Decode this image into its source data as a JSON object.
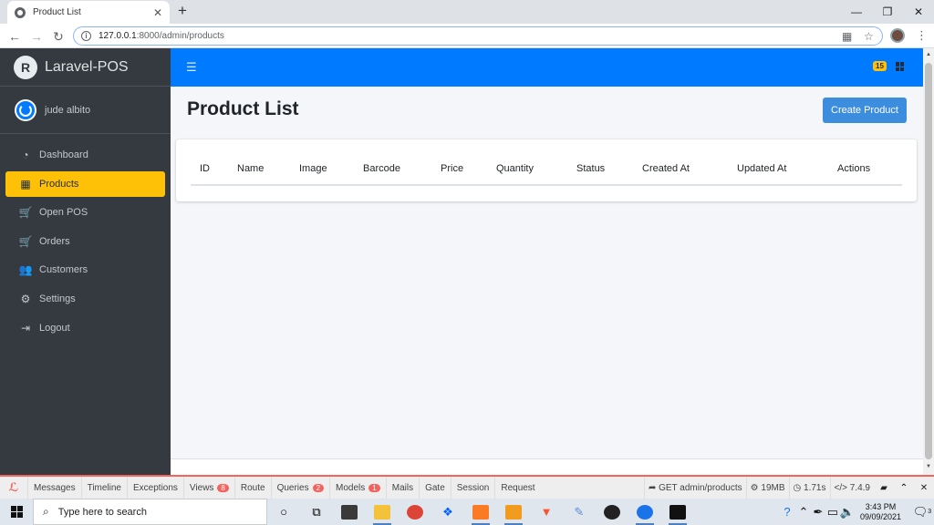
{
  "browser": {
    "tab_title": "Product List",
    "url_host": "127.0.0.1",
    "url_rest": ":8000/admin/products"
  },
  "app": {
    "brand": "Laravel-POS",
    "user_name": "jude albito",
    "notification_count": "15",
    "menu": [
      {
        "label": "Dashboard",
        "icon": "dashboard-icon",
        "active": false
      },
      {
        "label": "Products",
        "icon": "grid-icon",
        "active": true
      },
      {
        "label": "Open POS",
        "icon": "cart-icon",
        "active": false
      },
      {
        "label": "Orders",
        "icon": "cart-icon",
        "active": false
      },
      {
        "label": "Customers",
        "icon": "users-icon",
        "active": false
      },
      {
        "label": "Settings",
        "icon": "gears-icon",
        "active": false
      },
      {
        "label": "Logout",
        "icon": "logout-icon",
        "active": false
      }
    ],
    "page_title": "Product List",
    "create_button": "Create Product",
    "table_headers": [
      "ID",
      "Name",
      "Image",
      "Barcode",
      "Price",
      "Quantity",
      "Status",
      "Created At",
      "Updated At",
      "Actions"
    ],
    "colors": {
      "sidebar": "#343a40",
      "navbar": "#007bff",
      "active": "#ffc107",
      "button": "#3c8dde"
    }
  },
  "debugbar": {
    "tabs": [
      {
        "label": "Messages"
      },
      {
        "label": "Timeline"
      },
      {
        "label": "Exceptions"
      },
      {
        "label": "Views",
        "count": "8"
      },
      {
        "label": "Route"
      },
      {
        "label": "Queries",
        "count": "2"
      },
      {
        "label": "Models",
        "count": "1"
      },
      {
        "label": "Mails"
      },
      {
        "label": "Gate"
      },
      {
        "label": "Session"
      },
      {
        "label": "Request"
      }
    ],
    "request": "GET admin/products",
    "memory": "19MB",
    "time": "1.71s",
    "php": "7.4.9"
  },
  "taskbar": {
    "search_placeholder": "Type here to search",
    "time": "3:43 PM",
    "date": "09/09/2021",
    "notifications": "3"
  }
}
